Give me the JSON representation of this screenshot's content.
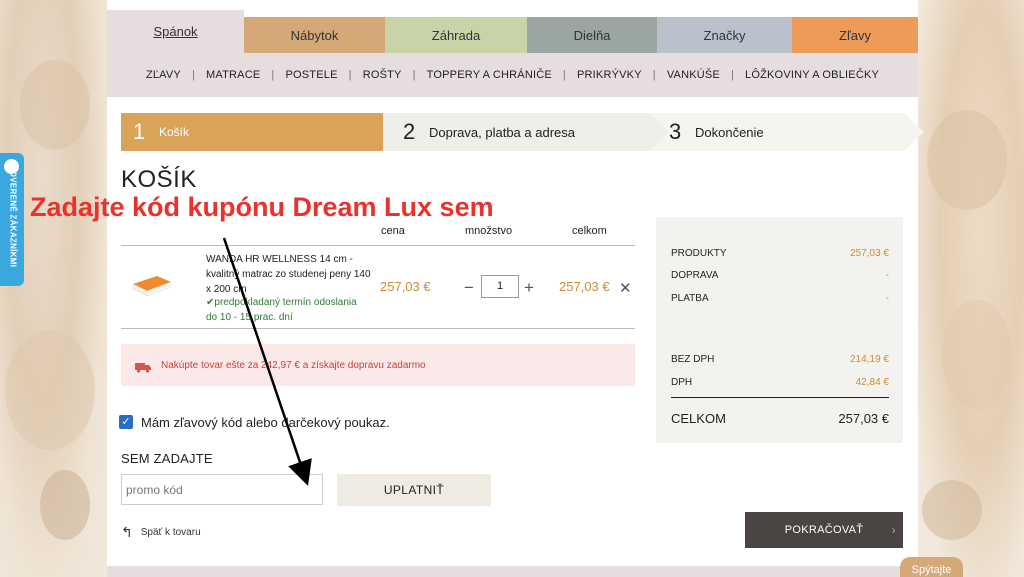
{
  "nav": {
    "tabs": [
      "Spánok",
      "Nábytok",
      "Záhrada",
      "Dielňa",
      "Značky",
      "Zľavy"
    ],
    "sub": [
      "ZĽAVY",
      "MATRACE",
      "POSTELE",
      "ROŠTY",
      "TOPPERY A CHRÁNIČE",
      "PRIKRÝVKY",
      "VANKÚŠE",
      "LÔŽKOVINY A OBLIEČKY"
    ]
  },
  "steps": [
    {
      "num": "1",
      "label": "Košík"
    },
    {
      "num": "2",
      "label": "Doprava, platba a adresa"
    },
    {
      "num": "3",
      "label": "Dokončenie"
    }
  ],
  "cart": {
    "title": "KOŠÍK",
    "col_price": "cena",
    "col_qty": "množstvo",
    "col_total": "celkom",
    "item": {
      "name": "WANDA HR WELLNESS 14 cm - kvalitný matrac zo studenej peny 140 x 200 cm",
      "shipping": "predpokladaný termín odoslania do 10 - 15 prac. dní",
      "price": "257,03 €",
      "qty": "1",
      "total": "257,03 €"
    },
    "notice": "Nakúpte tovar ešte za 242,97 € a získajte dopravu zadarmo",
    "coupon_checkbox": "Mám zľavový kód alebo darčekový poukaz.",
    "coupon_heading": "SEM ZADAJTE",
    "promo_placeholder": "promo kód",
    "apply_label": "UPLATNIŤ",
    "back_label": "Späť k tovaru",
    "continue_label": "POKRAČOVAŤ"
  },
  "summary": {
    "products_label": "PRODUKTY",
    "products_value": "257,03 €",
    "shipping_label": "DOPRAVA",
    "shipping_value": "-",
    "payment_label": "PLATBA",
    "payment_value": "-",
    "net_label": "BEZ DPH",
    "net_value": "214,19 €",
    "vat_label": "DPH",
    "vat_value": "42,84 €",
    "total_label": "CELKOM",
    "total_value": "257,03 €"
  },
  "overlay": {
    "annotation": "Zadajte kód kupónu Dream Lux sem",
    "verified": "OVERENÉ ZÁKAZNÍKMI",
    "ask": "Spýtajte"
  },
  "colors": {
    "accent": "#d9a35a",
    "annotation": "#e8322b",
    "verified_badge": "#3ba7df"
  }
}
